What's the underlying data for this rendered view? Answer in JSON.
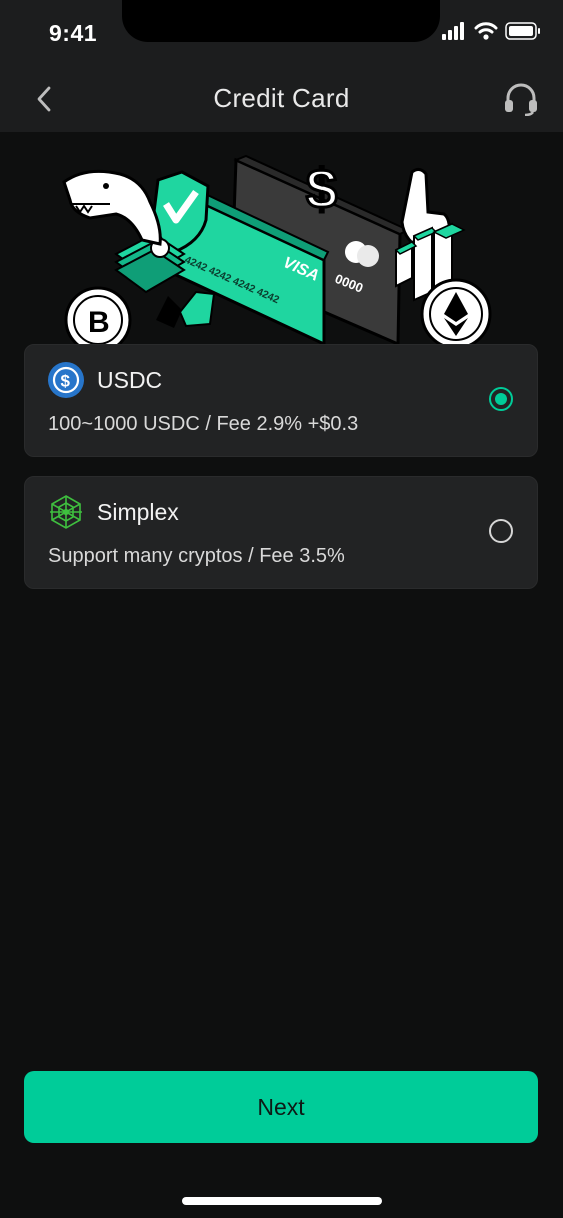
{
  "status_bar": {
    "time": "9:41"
  },
  "header": {
    "title": "Credit Card"
  },
  "hero": {
    "card_brand": "VISA",
    "card_number": "4242 4242 4242 4242",
    "back_card_number": "0000"
  },
  "options": [
    {
      "name": "USDC",
      "description": "100~1000 USDC / Fee 2.9% +$0.3",
      "selected": true
    },
    {
      "name": "Simplex",
      "description": "Support many cryptos / Fee 3.5%",
      "selected": false
    }
  ],
  "footer": {
    "next_label": "Next"
  },
  "colors": {
    "accent": "#00cc99",
    "background": "#0e0f0f",
    "card": "#222324",
    "header": "#1c1d1e",
    "usdc_blue": "#2775ca",
    "simplex_green": "#3fbf3f"
  },
  "icons": [
    "back-chevron-icon",
    "headset-icon",
    "usdc-icon",
    "simplex-icon",
    "signal-icon",
    "wifi-icon",
    "battery-icon"
  ]
}
